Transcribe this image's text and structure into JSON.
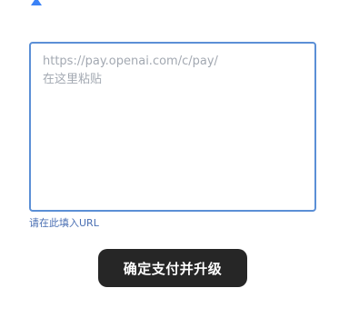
{
  "brand": {
    "icon": "a-logo-icon",
    "accent": "#3b82f6"
  },
  "url_input": {
    "value": "",
    "placeholder": "https://pay.openai.com/c/pay/\n在这里粘贴",
    "border_color": "#5b8fd6"
  },
  "hint": {
    "text": "请在此填入URL",
    "color": "#4a6fb3"
  },
  "confirm_button": {
    "label": "确定支付并升级",
    "background": "#262626",
    "text_color": "#ffffff"
  }
}
